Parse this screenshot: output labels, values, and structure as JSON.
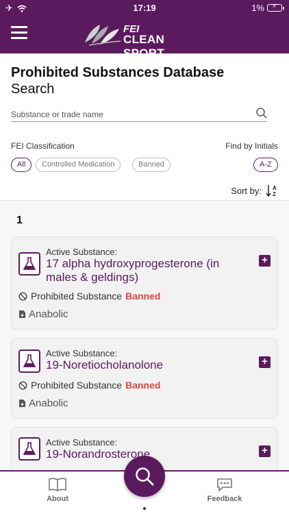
{
  "status_bar": {
    "time": "17:19",
    "battery": "1%"
  },
  "header": {
    "brand_top": "FEI",
    "brand_bottom": "CLEAN SPORT"
  },
  "search": {
    "title": "Prohibited Substances Database",
    "subtitle": "Search",
    "placeholder": "Substance or trade name",
    "value": ""
  },
  "filters": {
    "classification_label": "FEI Classification",
    "initials_label": "Find by Initials",
    "chips": [
      {
        "label": "All",
        "selected": true
      },
      {
        "label": "Controlled Medication",
        "selected": false
      },
      {
        "label": "Banned",
        "selected": false
      }
    ],
    "az_label": "A-Z",
    "sort_label": "Sort by:"
  },
  "list": {
    "group_letter": "1",
    "items": [
      {
        "label": "Active Substance:",
        "name": "17 alpha hydroxyprogesterone (in males & geldings)",
        "status_prefix": "Prohibited Substance",
        "status": "Banned",
        "category": "Anabolic"
      },
      {
        "label": "Active Substance:",
        "name": "19-Noretiocholanolone",
        "status_prefix": "Prohibited Substance",
        "status": "Banned",
        "category": "Anabolic"
      },
      {
        "label": "Active Substance:",
        "name": "19-Norandrosterone"
      }
    ]
  },
  "bottom_nav": {
    "about": "About",
    "feedback": "Feedback"
  },
  "colors": {
    "brand": "#5b1a5e",
    "banned": "#d9473d"
  }
}
